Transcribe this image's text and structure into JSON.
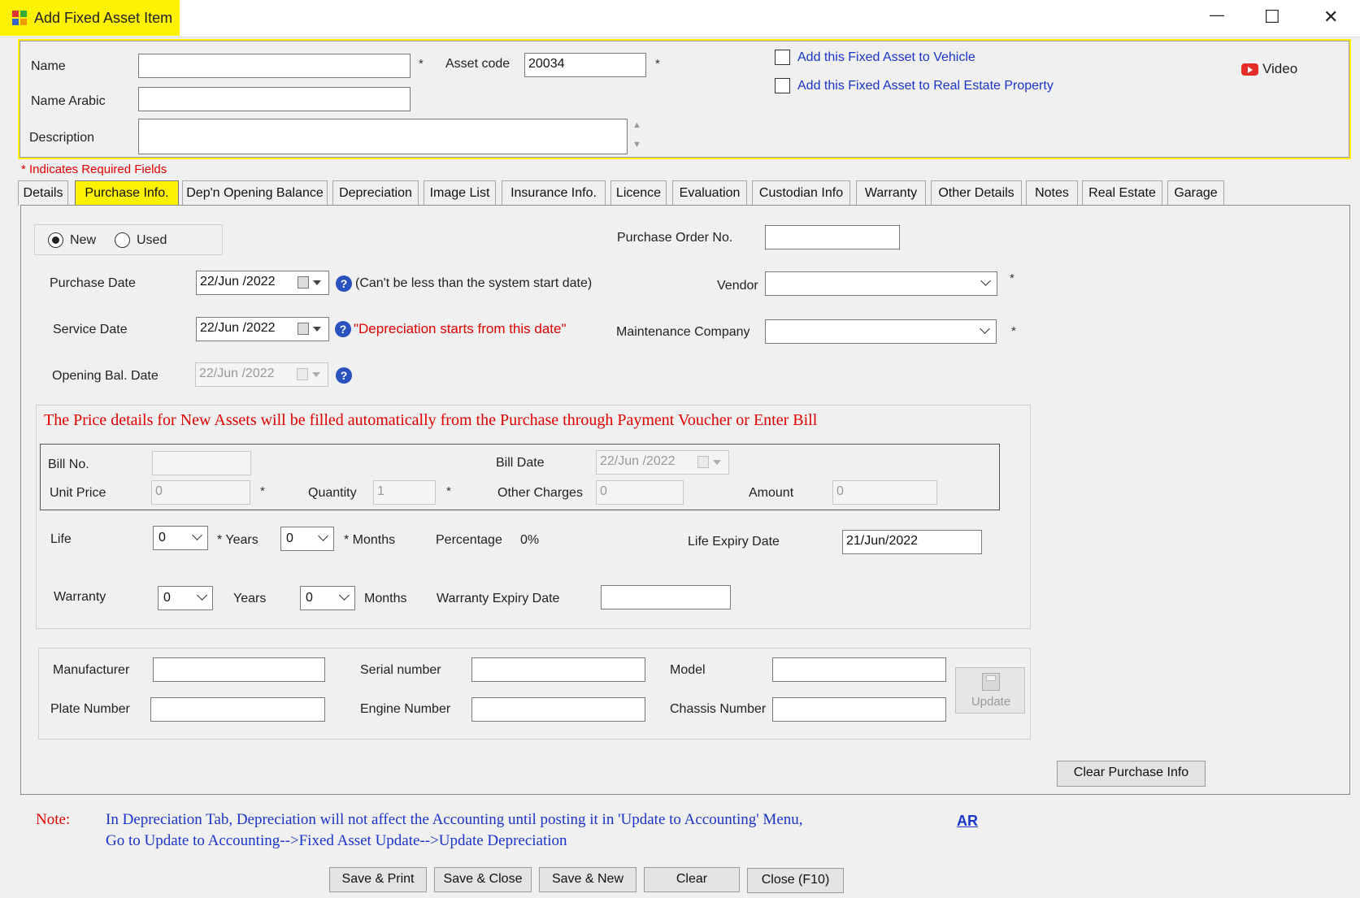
{
  "window": {
    "title": "Add Fixed Asset Item",
    "controls": {
      "minimize": "—",
      "maximize": "☐",
      "close": "✕"
    }
  },
  "header": {
    "name_label": "Name",
    "name_value": "",
    "asset_code_label": "Asset code",
    "asset_code_value": "20034",
    "name_arabic_label": "Name Arabic",
    "name_arabic_value": "",
    "description_label": "Description",
    "description_value": "",
    "vehicle_checkbox": "Add this Fixed Asset to Vehicle",
    "real_estate_checkbox": "Add this Fixed Asset to Real Estate Property",
    "video_label": "Video",
    "required_note": "* Indicates Required Fields",
    "star": "*"
  },
  "tabs": [
    {
      "label": "Details"
    },
    {
      "label": "Purchase Info."
    },
    {
      "label": "Dep'n Opening Balance"
    },
    {
      "label": "Depreciation"
    },
    {
      "label": "Image List"
    },
    {
      "label": "Insurance Info."
    },
    {
      "label": "Licence"
    },
    {
      "label": "Evaluation"
    },
    {
      "label": "Custodian Info"
    },
    {
      "label": "Warranty"
    },
    {
      "label": "Other Details"
    },
    {
      "label": "Notes"
    },
    {
      "label": "Real Estate"
    },
    {
      "label": "Garage"
    }
  ],
  "purchase": {
    "new_label": "New",
    "used_label": "Used",
    "selected": "New",
    "po_label": "Purchase Order No.",
    "po_value": "",
    "purchase_date_label": "Purchase Date",
    "purchase_date_value": "22/Jun /2022",
    "purchase_date_hint": "(Can't be less than the system start date)",
    "vendor_label": "Vendor",
    "vendor_value": "",
    "service_date_label": "Service Date",
    "service_date_value": "22/Jun /2022",
    "service_date_hint": "\"Depreciation starts from this date\"",
    "maintenance_label": "Maintenance Company",
    "maintenance_value": "",
    "opening_bal_label": "Opening Bal. Date",
    "opening_bal_value": "22/Jun /2022",
    "help_glyph": "?"
  },
  "price": {
    "notice": "The Price details for New Assets will be filled automatically from the Purchase through Payment Voucher or Enter Bill",
    "bill_no_label": "Bill No.",
    "bill_no_value": "",
    "bill_date_label": "Bill Date",
    "bill_date_value": "22/Jun /2022",
    "unit_price_label": "Unit Price",
    "unit_price_value": "0",
    "quantity_label": "Quantity",
    "quantity_value": "1",
    "other_charges_label": "Other Charges",
    "other_charges_value": "0",
    "amount_label": "Amount",
    "amount_value": "0"
  },
  "life": {
    "life_label": "Life",
    "life_years_value": "0",
    "years_label": "* Years",
    "life_months_value": "0",
    "months_label": "* Months",
    "percentage_label": "Percentage",
    "percentage_value": "0%",
    "expiry_label": "Life Expiry Date",
    "expiry_value": "21/Jun/2022",
    "warranty_label": "Warranty",
    "warranty_years_value": "0",
    "warranty_years_label": "Years",
    "warranty_months_value": "0",
    "warranty_months_label": "Months",
    "warranty_expiry_label": "Warranty Expiry Date",
    "warranty_expiry_value": ""
  },
  "vehicle": {
    "manufacturer_label": "Manufacturer",
    "manufacturer_value": "",
    "serial_label": "Serial number",
    "serial_value": "",
    "model_label": "Model",
    "model_value": "",
    "plate_label": "Plate Number",
    "plate_value": "",
    "engine_label": "Engine Number",
    "engine_value": "",
    "chassis_label": "Chassis Number",
    "chassis_value": "",
    "update_label": "Update"
  },
  "clear_purchase_label": "Clear Purchase Info",
  "note": {
    "label": "Note:",
    "line1": "In Depreciation Tab, Depreciation will not affect the Accounting until posting it in 'Update to Accounting' Menu,",
    "line2": "Go to Update to Accounting-->Fixed Asset Update-->Update Depreciation",
    "ar_link": "AR"
  },
  "footer": {
    "save_print": "Save & Print",
    "save_close": "Save & Close",
    "save_new": "Save & New",
    "clear": "Clear",
    "close": "Close (F10)"
  },
  "colors": {
    "highlight": "#fff200",
    "required_red": "#e00000",
    "link_blue": "#1a34c9",
    "video_red": "#e52d27"
  }
}
